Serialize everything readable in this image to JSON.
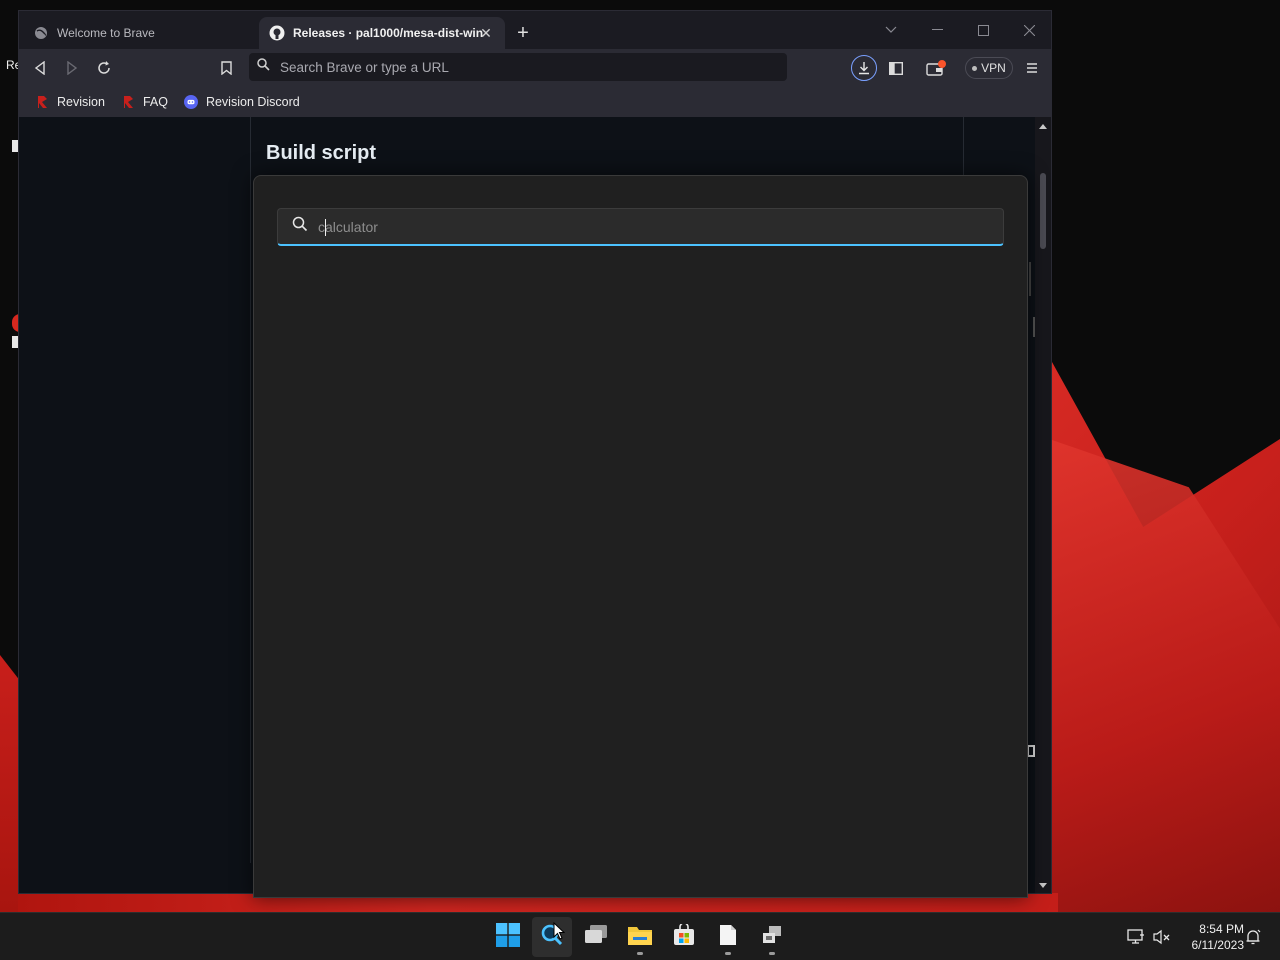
{
  "desktop": {
    "partial_label": "Re"
  },
  "browser": {
    "tabs": [
      {
        "label": "Welcome to Brave",
        "active": false
      },
      {
        "label": "Releases · pal1000/mesa-dist-win",
        "active": true
      }
    ],
    "toolbar": {
      "url_placeholder": "Search Brave or type a URL",
      "vpn_label": "VPN"
    },
    "bookmarks": [
      {
        "label": "Revision",
        "icon": "revision-icon"
      },
      {
        "label": "FAQ",
        "icon": "revision-icon"
      },
      {
        "label": "Revision Discord",
        "icon": "discord-icon"
      }
    ],
    "page": {
      "heading": "Build script"
    }
  },
  "search": {
    "query": "",
    "placeholder": "calculator",
    "accent_color": "#4cc2ff"
  },
  "taskbar": {
    "apps": [
      {
        "name": "start",
        "icon": "windows-logo-icon"
      },
      {
        "name": "search",
        "icon": "search-icon",
        "active": true
      },
      {
        "name": "task-view",
        "icon": "task-view-icon"
      },
      {
        "name": "file-explorer",
        "icon": "folder-icon",
        "running": true
      },
      {
        "name": "microsoft-store",
        "icon": "store-icon"
      },
      {
        "name": "notepad",
        "icon": "document-icon",
        "running": true
      },
      {
        "name": "app",
        "icon": "app-icon",
        "running": true
      }
    ],
    "clock": {
      "time": "8:54 PM",
      "date": "6/11/2023"
    }
  },
  "colors": {
    "brave_orange": "#fb542b",
    "revision_red": "#d7281f",
    "discord_blurple": "#5865f2",
    "page_bg": "#0d1117",
    "panel_bg": "#202020"
  }
}
